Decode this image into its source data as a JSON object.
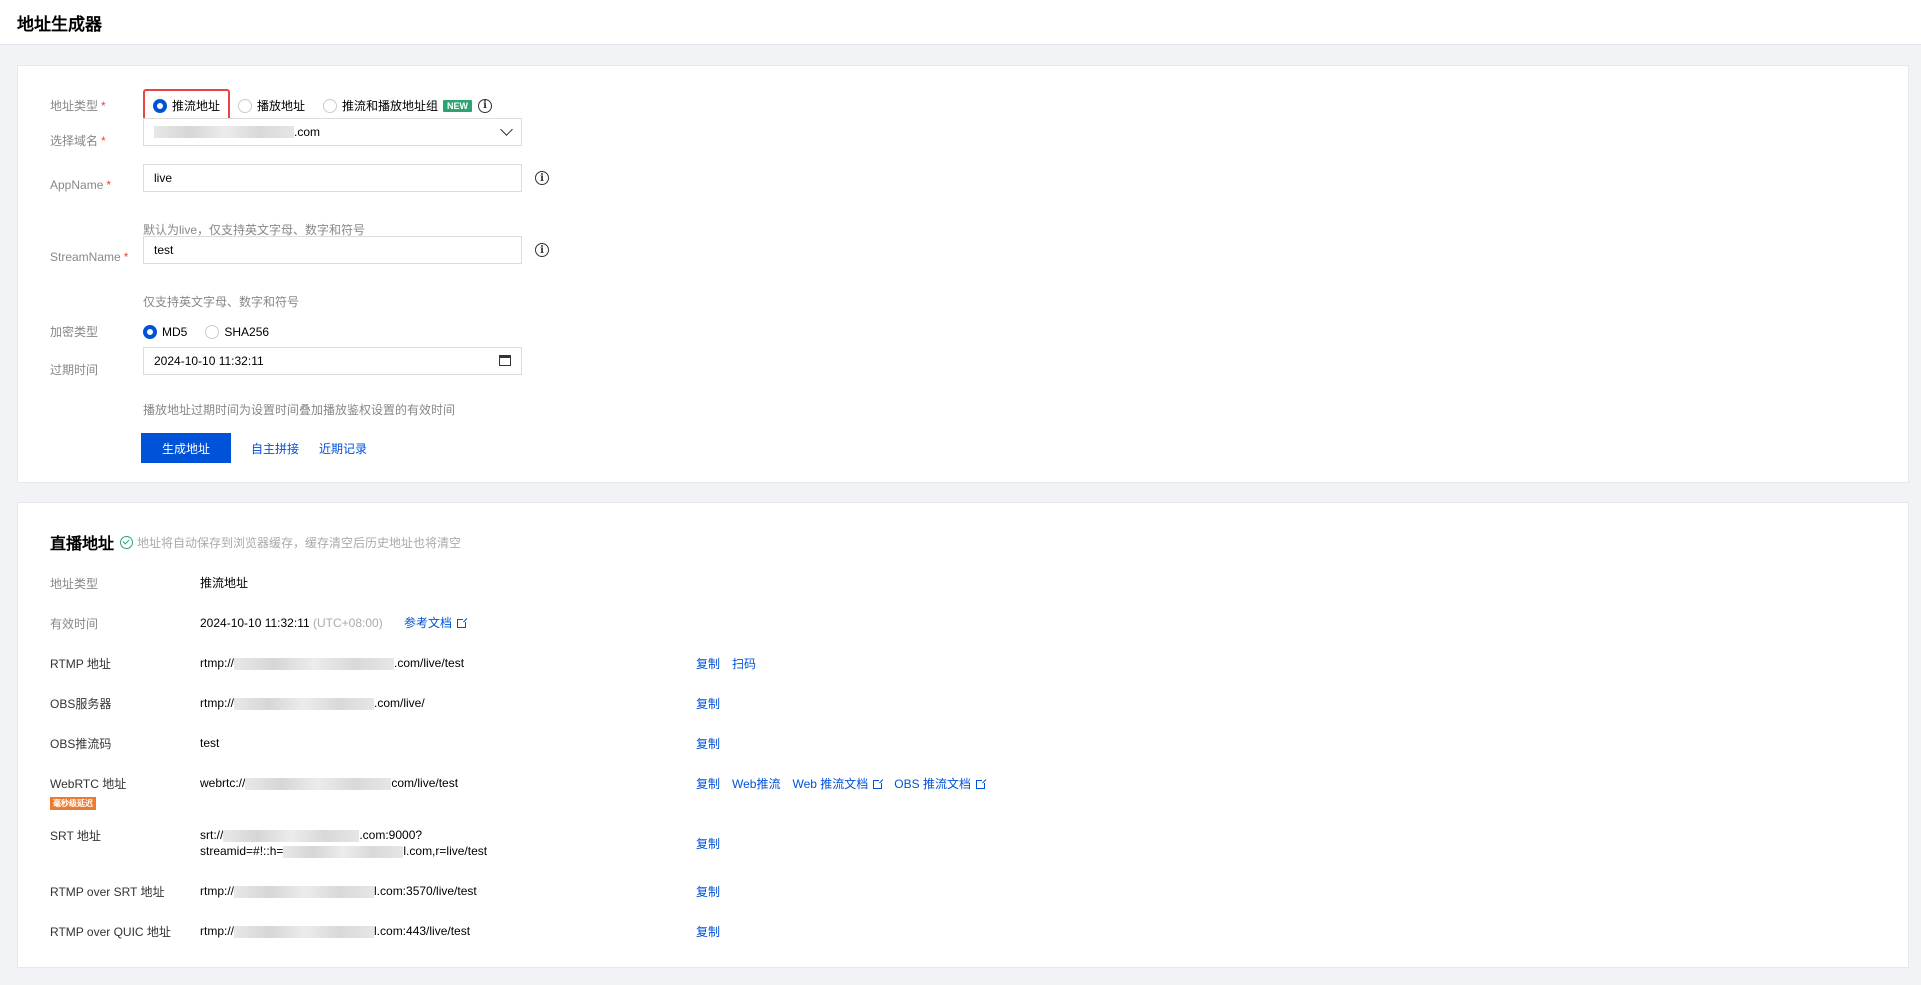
{
  "page_title": "地址生成器",
  "form": {
    "addr_type_label": "地址类型",
    "addr_type_options": [
      "推流地址",
      "播放地址",
      "推流和播放地址组"
    ],
    "new_badge": "NEW",
    "domain_label": "选择域名",
    "domain_value_suffix": ".com",
    "appname_label": "AppName",
    "appname_value": "live",
    "appname_hint": "默认为live，仅支持英文字母、数字和符号",
    "streamname_label": "StreamName",
    "streamname_value": "test",
    "streamname_hint": "仅支持英文字母、数字和符号",
    "encrypt_label": "加密类型",
    "encrypt_options": [
      "MD5",
      "SHA256"
    ],
    "expire_label": "过期时间",
    "expire_value": "2024-10-10 11:32:11",
    "expire_hint": "播放地址过期时间为设置时间叠加播放鉴权设置的有效时间",
    "generate_button": "生成地址",
    "custom_link": "自主拼接",
    "recent_link": "近期记录"
  },
  "result": {
    "title": "直播地址",
    "subtitle": "地址将自动保存到浏览器缓存，缓存清空后历史地址也将清空",
    "type_label": "地址类型",
    "type_value": "推流地址",
    "valid_label": "有效时间",
    "valid_value": "2024-10-10 11:32:11",
    "valid_tz": "(UTC+08:00)",
    "ref_doc": "参考文档",
    "copy": "复制",
    "scan": "扫码",
    "rtmp_label": "RTMP 地址",
    "rtmp_prefix": "rtmp://",
    "rtmp_suffix": ".com/live/test",
    "obs_server_label": "OBS服务器",
    "obs_server_prefix": "rtmp://",
    "obs_server_suffix": ".com/live/",
    "obs_key_label": "OBS推流码",
    "obs_key_value": "test",
    "webrtc_label": "WebRTC 地址",
    "webrtc_badge": "毫秒级延迟",
    "webrtc_prefix": "webrtc://",
    "webrtc_suffix": "com/live/test",
    "web_push": "Web推流",
    "web_push_doc": "Web 推流文档",
    "obs_push_doc": "OBS 推流文档",
    "srt_label": "SRT 地址",
    "srt_line1_prefix": "srt://",
    "srt_line1_suffix": ".com:9000?",
    "srt_line2_prefix": "streamid=#!::h=",
    "srt_line2_suffix": "l.com,r=live/test",
    "rtmp_srt_label": "RTMP over SRT 地址",
    "rtmp_srt_prefix": "rtmp://",
    "rtmp_srt_suffix": "l.com:3570/live/test",
    "rtmp_quic_label": "RTMP over QUIC 地址",
    "rtmp_quic_prefix": "rtmp://",
    "rtmp_quic_suffix": "l.com:443/live/test"
  },
  "colors": {
    "primary": "#0052d9",
    "required": "#e54545",
    "success": "#2ba471",
    "warning": "#ed7b2f"
  }
}
